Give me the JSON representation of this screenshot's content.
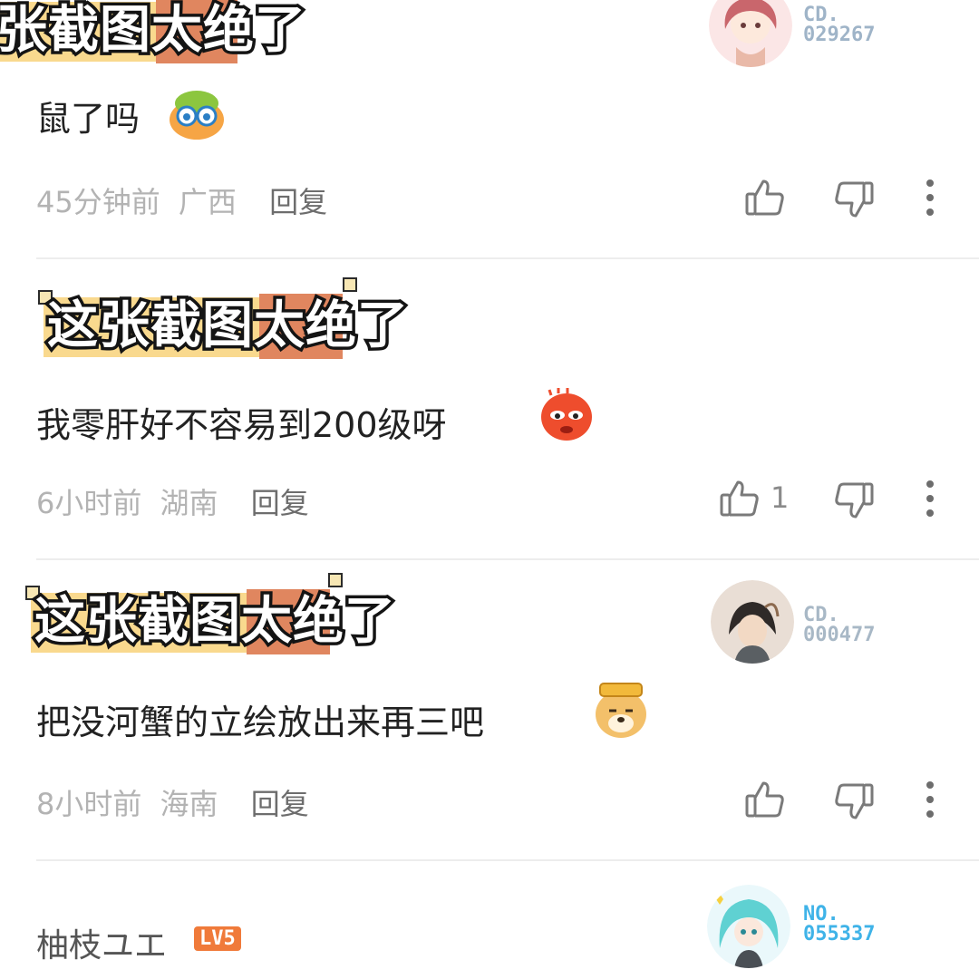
{
  "banner_text": "这张截图太绝了",
  "banner_text_cropped": "张截图太绝了",
  "comments": [
    {
      "text": "鼠了吗",
      "time": "45分钟前",
      "location": "广西",
      "reply_label": "回复",
      "like_count": "",
      "avatar_badge": {
        "prefix": "CD.",
        "number": "029267",
        "color": "#9fb4c8"
      }
    },
    {
      "text": "我零肝好不容易到200级呀",
      "time": "6小时前",
      "location": "湖南",
      "reply_label": "回复",
      "like_count": "1"
    },
    {
      "text": "把没河蟹的立绘放出来再三吧",
      "time": "8小时前",
      "location": "海南",
      "reply_label": "回复",
      "like_count": "",
      "avatar_badge": {
        "prefix": "CD.",
        "number": "000477",
        "color": "#a8b8c6"
      }
    }
  ],
  "next_comment": {
    "username": "柚枝ユエ",
    "level": "LV5",
    "avatar_badge": {
      "prefix": "NO.",
      "number": "055337",
      "color": "#3fb3e8"
    }
  },
  "colors": {
    "meta_gray": "#b3b3b3",
    "reply_gray": "#6d6d6d",
    "icon_gray": "#7a7a7a",
    "banner_yellow": "#f9d98e",
    "banner_orange": "#e0865f",
    "level_orange": "#f07a3a"
  },
  "icons": [
    "thumbs-up-icon",
    "thumbs-down-icon",
    "more-vertical-icon"
  ]
}
